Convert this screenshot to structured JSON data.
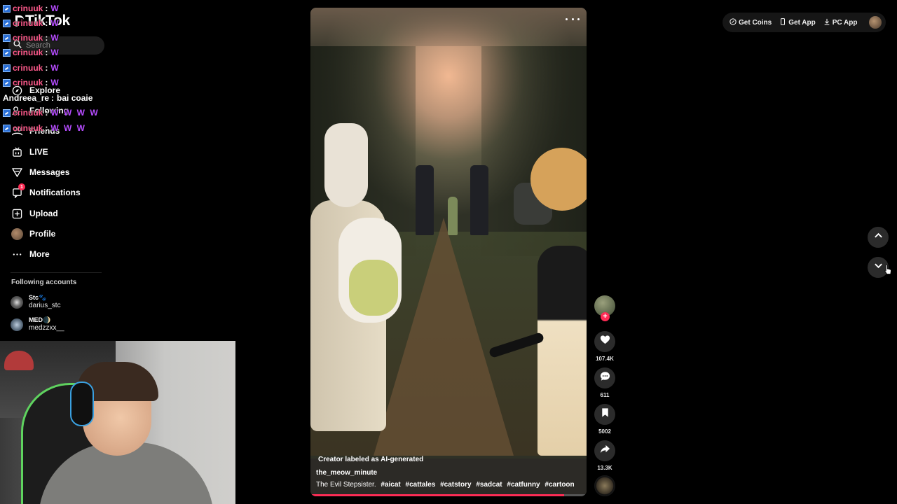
{
  "sidebar": {
    "logo": "TikTok",
    "search_placeholder": "Search",
    "nav": [
      {
        "label": "Explore",
        "icon": "compass-icon"
      },
      {
        "label": "Following",
        "icon": "following-icon"
      },
      {
        "label": "Friends",
        "icon": "friends-icon"
      },
      {
        "label": "LIVE",
        "icon": "live-icon"
      },
      {
        "label": "Messages",
        "icon": "messages-icon"
      },
      {
        "label": "Notifications",
        "icon": "notifications-icon",
        "badge": "1"
      },
      {
        "label": "Upload",
        "icon": "upload-icon"
      },
      {
        "label": "Profile",
        "icon": "profile-avatar"
      },
      {
        "label": "More",
        "icon": "more-icon"
      }
    ],
    "following_title": "Following accounts",
    "accounts": [
      {
        "name": "Stc🐾",
        "handle": "darius_stc"
      },
      {
        "name": "MED🌒",
        "handle": "medzzxx__"
      }
    ]
  },
  "chat": [
    {
      "user": "crinuuk",
      "message": "W"
    },
    {
      "user": "crinuuk",
      "message": "W"
    },
    {
      "user": "crinuuk",
      "message": "W"
    },
    {
      "user": "crinuuk",
      "message": "W"
    },
    {
      "user": "crinuuk",
      "message": "W"
    },
    {
      "user": "crinuuk",
      "message": "W"
    },
    {
      "user": "Andreea_re",
      "message": "bai coaie"
    },
    {
      "user": "crinuuk",
      "message": "W W W W"
    },
    {
      "user": "crinuuk",
      "message": "W W W"
    }
  ],
  "video": {
    "ai_label": "Creator labeled as AI-generated",
    "author": "the_meow_minute",
    "description": "The Evil Stepsister.",
    "hashtags": [
      "#aicat",
      "#cattales",
      "#catstory",
      "#sadcat",
      "#catfunny",
      "#cartoon"
    ],
    "progress": 0.92
  },
  "actions": {
    "likes": "107.4K",
    "comments": "611",
    "saves": "5002",
    "shares": "13.3K",
    "follow_plus": "+"
  },
  "topbar": {
    "get_coins": "Get Coins",
    "get_app": "Get App",
    "pc_app": "PC App"
  },
  "colors": {
    "accent": "#fe2c55",
    "chat_user": "#ff5a8c",
    "chat_emote": "#b64cff"
  }
}
